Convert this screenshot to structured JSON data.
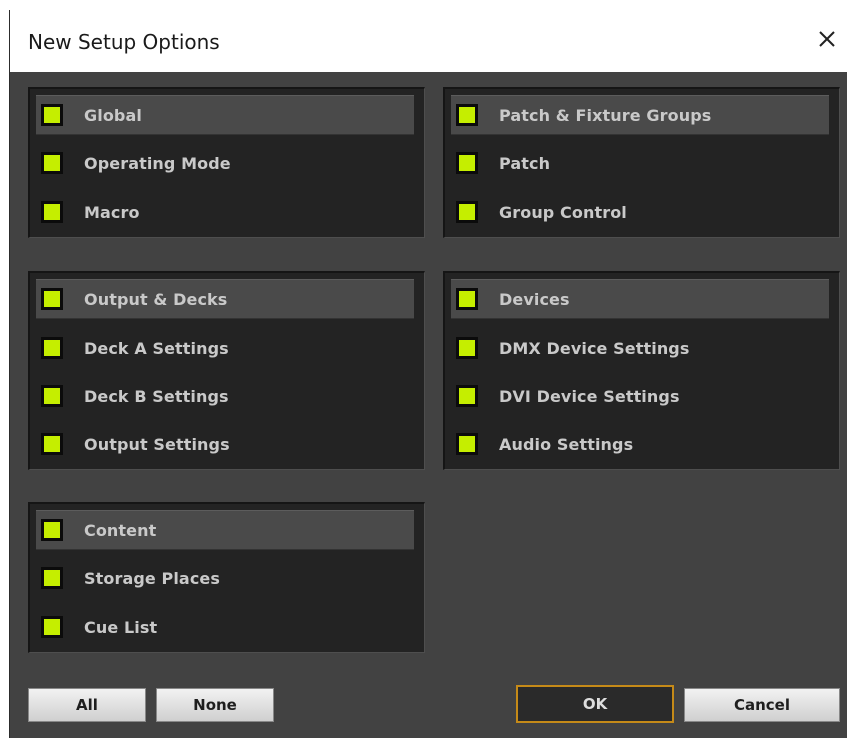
{
  "dialog": {
    "title": "New Setup Options"
  },
  "colors": {
    "checkbox": "#c5ee00",
    "ok_border": "#c58a18",
    "panel_bg": "#232323",
    "dialog_bg": "#424242"
  },
  "panels": {
    "global": {
      "header": "Global",
      "items": [
        "Operating Mode",
        "Macro"
      ]
    },
    "patch": {
      "header": "Patch & Fixture Groups",
      "items": [
        "Patch",
        "Group Control"
      ]
    },
    "output": {
      "header": "Output & Decks",
      "items": [
        "Deck A Settings",
        "Deck B Settings",
        "Output Settings"
      ]
    },
    "devices": {
      "header": "Devices",
      "items": [
        "DMX Device Settings",
        "DVI Device Settings",
        "Audio Settings"
      ]
    },
    "content": {
      "header": "Content",
      "items": [
        "Storage Places",
        "Cue List"
      ]
    }
  },
  "buttons": {
    "all": "All",
    "none": "None",
    "ok": "OK",
    "cancel": "Cancel"
  }
}
